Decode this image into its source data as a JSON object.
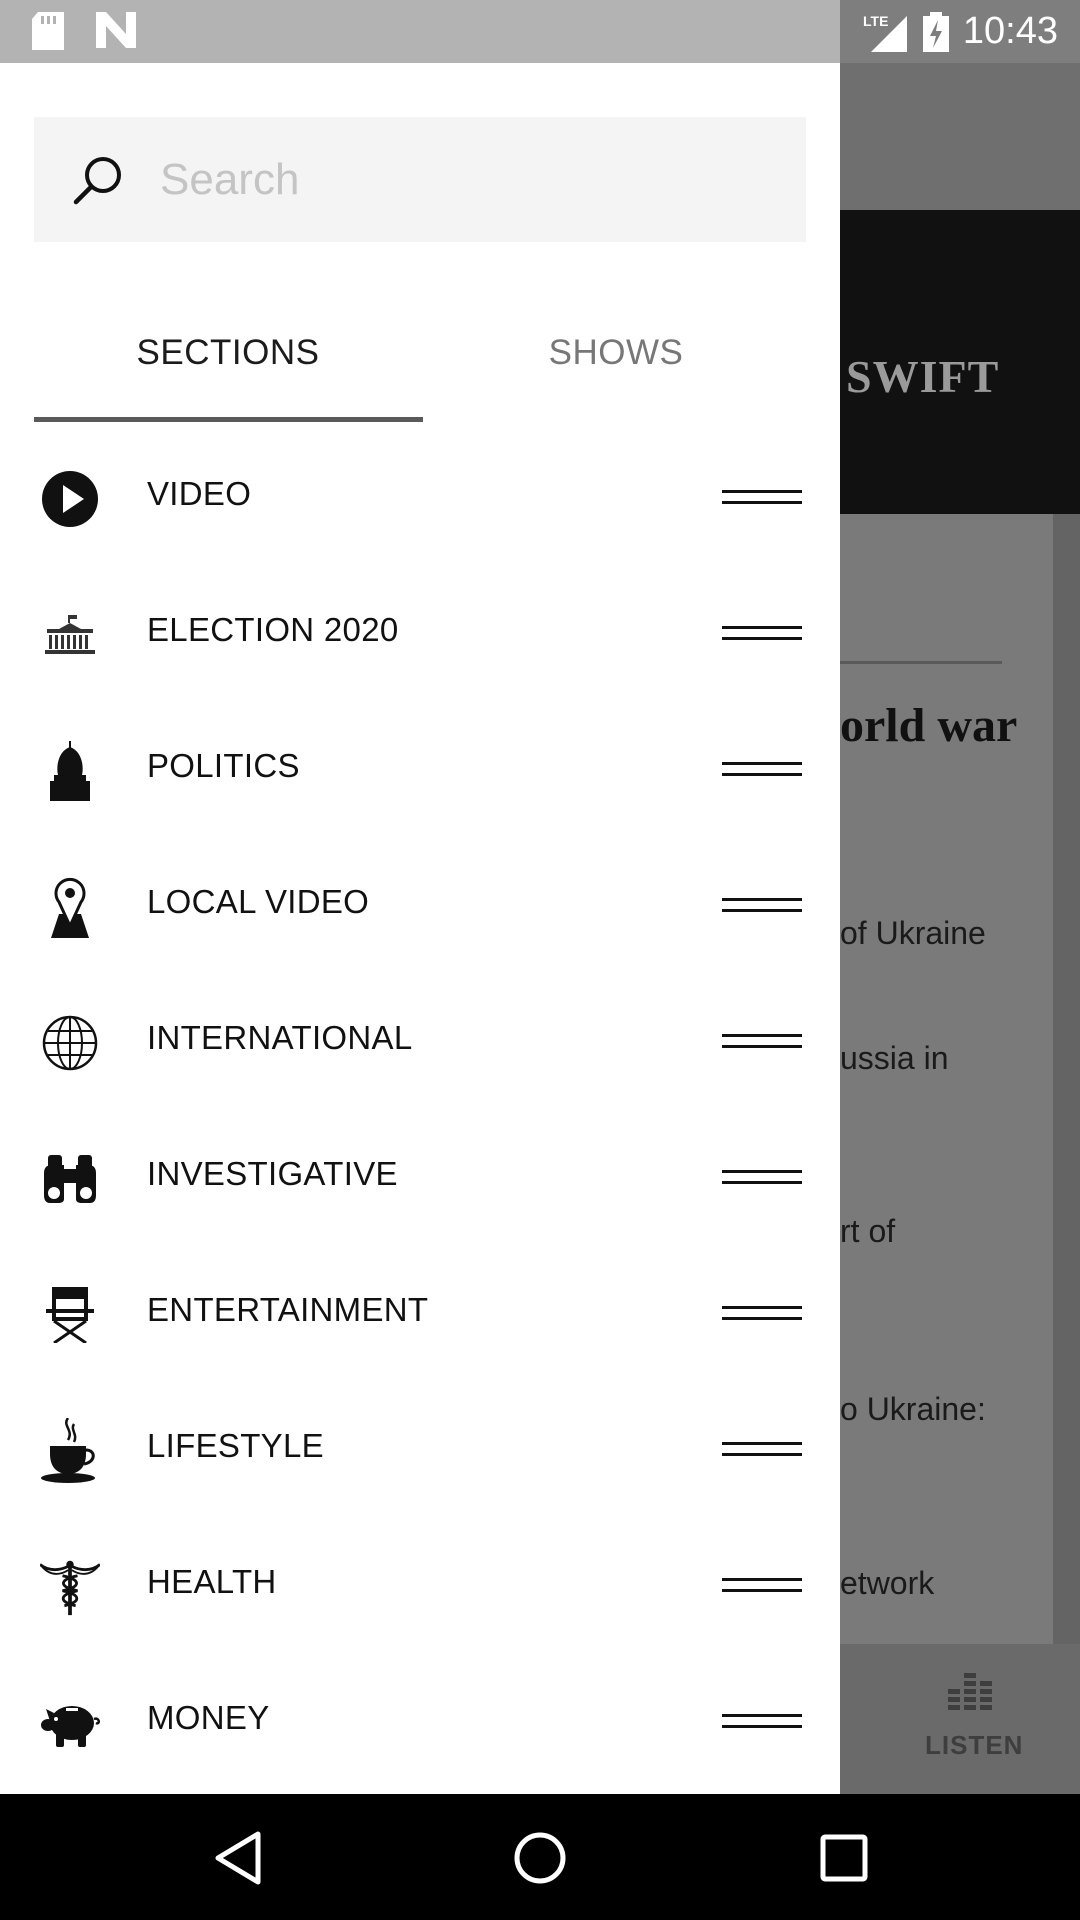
{
  "status_bar": {
    "time": "10:43",
    "network": "LTE",
    "icons_left": [
      "sd-card-icon",
      "n-notification-icon"
    ]
  },
  "background": {
    "hero_text": "SWIFT",
    "headline_fragment": "orld war",
    "lines": [
      "of Ukraine",
      "ussia in",
      "rt of",
      "o Ukraine:",
      "etwork"
    ],
    "bottom_nav_label": "LISTEN"
  },
  "drawer": {
    "search": {
      "placeholder": "Search",
      "value": ""
    },
    "tabs": [
      {
        "label": "SECTIONS",
        "selected": true
      },
      {
        "label": "SHOWS",
        "selected": false
      }
    ],
    "sections": [
      {
        "label": "VIDEO",
        "icon": "play-circle-icon"
      },
      {
        "label": "ELECTION 2020",
        "icon": "white-house-icon"
      },
      {
        "label": "POLITICS",
        "icon": "capitol-dome-icon"
      },
      {
        "label": "LOCAL VIDEO",
        "icon": "map-pin-icon"
      },
      {
        "label": "INTERNATIONAL",
        "icon": "globe-icon"
      },
      {
        "label": "INVESTIGATIVE",
        "icon": "binoculars-icon"
      },
      {
        "label": "ENTERTAINMENT",
        "icon": "directors-chair-icon"
      },
      {
        "label": "LIFESTYLE",
        "icon": "coffee-cup-icon"
      },
      {
        "label": "HEALTH",
        "icon": "caduceus-icon"
      },
      {
        "label": "MONEY",
        "icon": "piggy-bank-icon"
      }
    ]
  },
  "colors": {
    "status_bar": "#b3b3b3",
    "drawer_bg": "#ffffff",
    "search_bg": "#f4f4f4",
    "tab_indicator": "#5a5a5a",
    "nav_bar": "#000000"
  }
}
